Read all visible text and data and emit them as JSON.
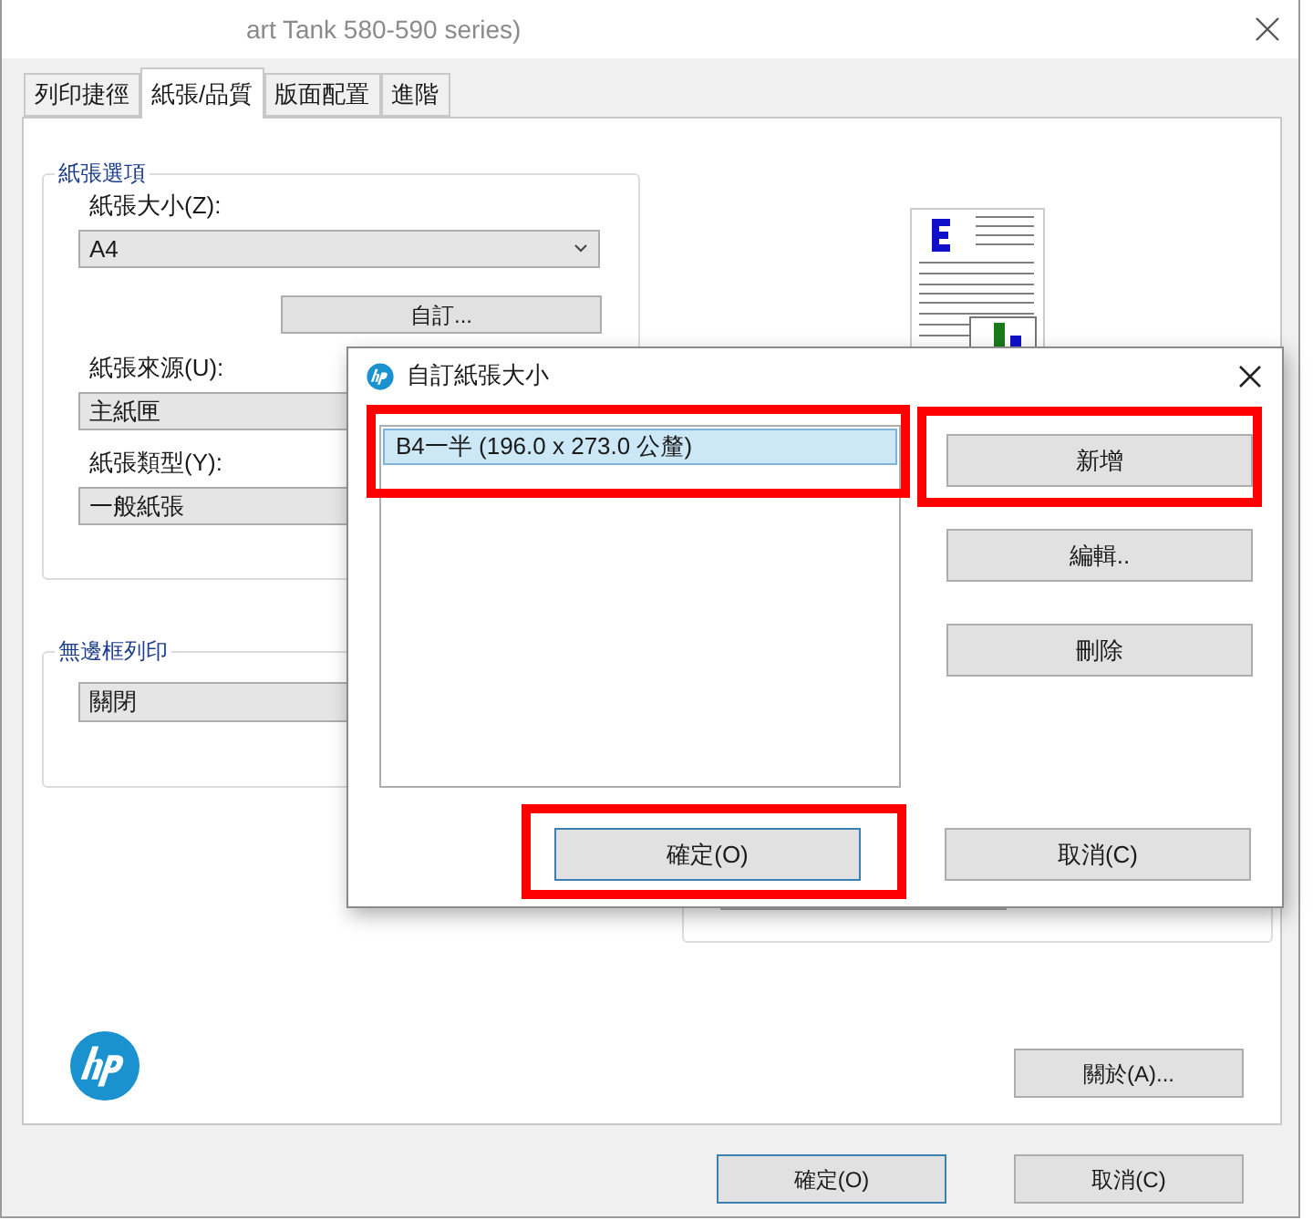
{
  "window": {
    "title": "art Tank 580-590 series)"
  },
  "tabs": [
    {
      "label": "列印捷徑",
      "selected": false
    },
    {
      "label": "紙張/品質",
      "selected": true
    },
    {
      "label": "版面配置",
      "selected": false
    },
    {
      "label": "進階",
      "selected": false
    }
  ],
  "paper_options": {
    "title": "紙張選項",
    "fields": [
      {
        "kind": "dropdown",
        "label": "紙張大小(Z):",
        "value": "A4"
      },
      {
        "kind": "button",
        "label": "自訂..."
      },
      {
        "kind": "dropdown",
        "label": "紙張來源(U):",
        "value": "主紙匣"
      },
      {
        "kind": "dropdown",
        "label": "紙張類型(Y):",
        "value": "一般紙張"
      }
    ]
  },
  "borderless": {
    "title": "無邊框列印",
    "value": "關閉"
  },
  "about_button": "關於(A)...",
  "buttons": [
    {
      "label": "確定(O)",
      "focused": true
    },
    {
      "label": "取消(C)",
      "focused": false
    }
  ],
  "dialog": {
    "title": "自訂紙張大小",
    "sizes": [
      {
        "label": "B4一半 (196.0 x 273.0 公釐)",
        "selected": true,
        "highlighted": true
      }
    ],
    "side_buttons": [
      {
        "label": "新增",
        "highlighted": true
      },
      {
        "label": "編輯..",
        "highlighted": false
      },
      {
        "label": "刪除",
        "highlighted": false
      }
    ],
    "bottom_buttons": [
      {
        "label": "確定(O)",
        "focused": true,
        "highlighted": true
      },
      {
        "label": "取消(C)",
        "focused": false,
        "highlighted": false
      }
    ]
  }
}
